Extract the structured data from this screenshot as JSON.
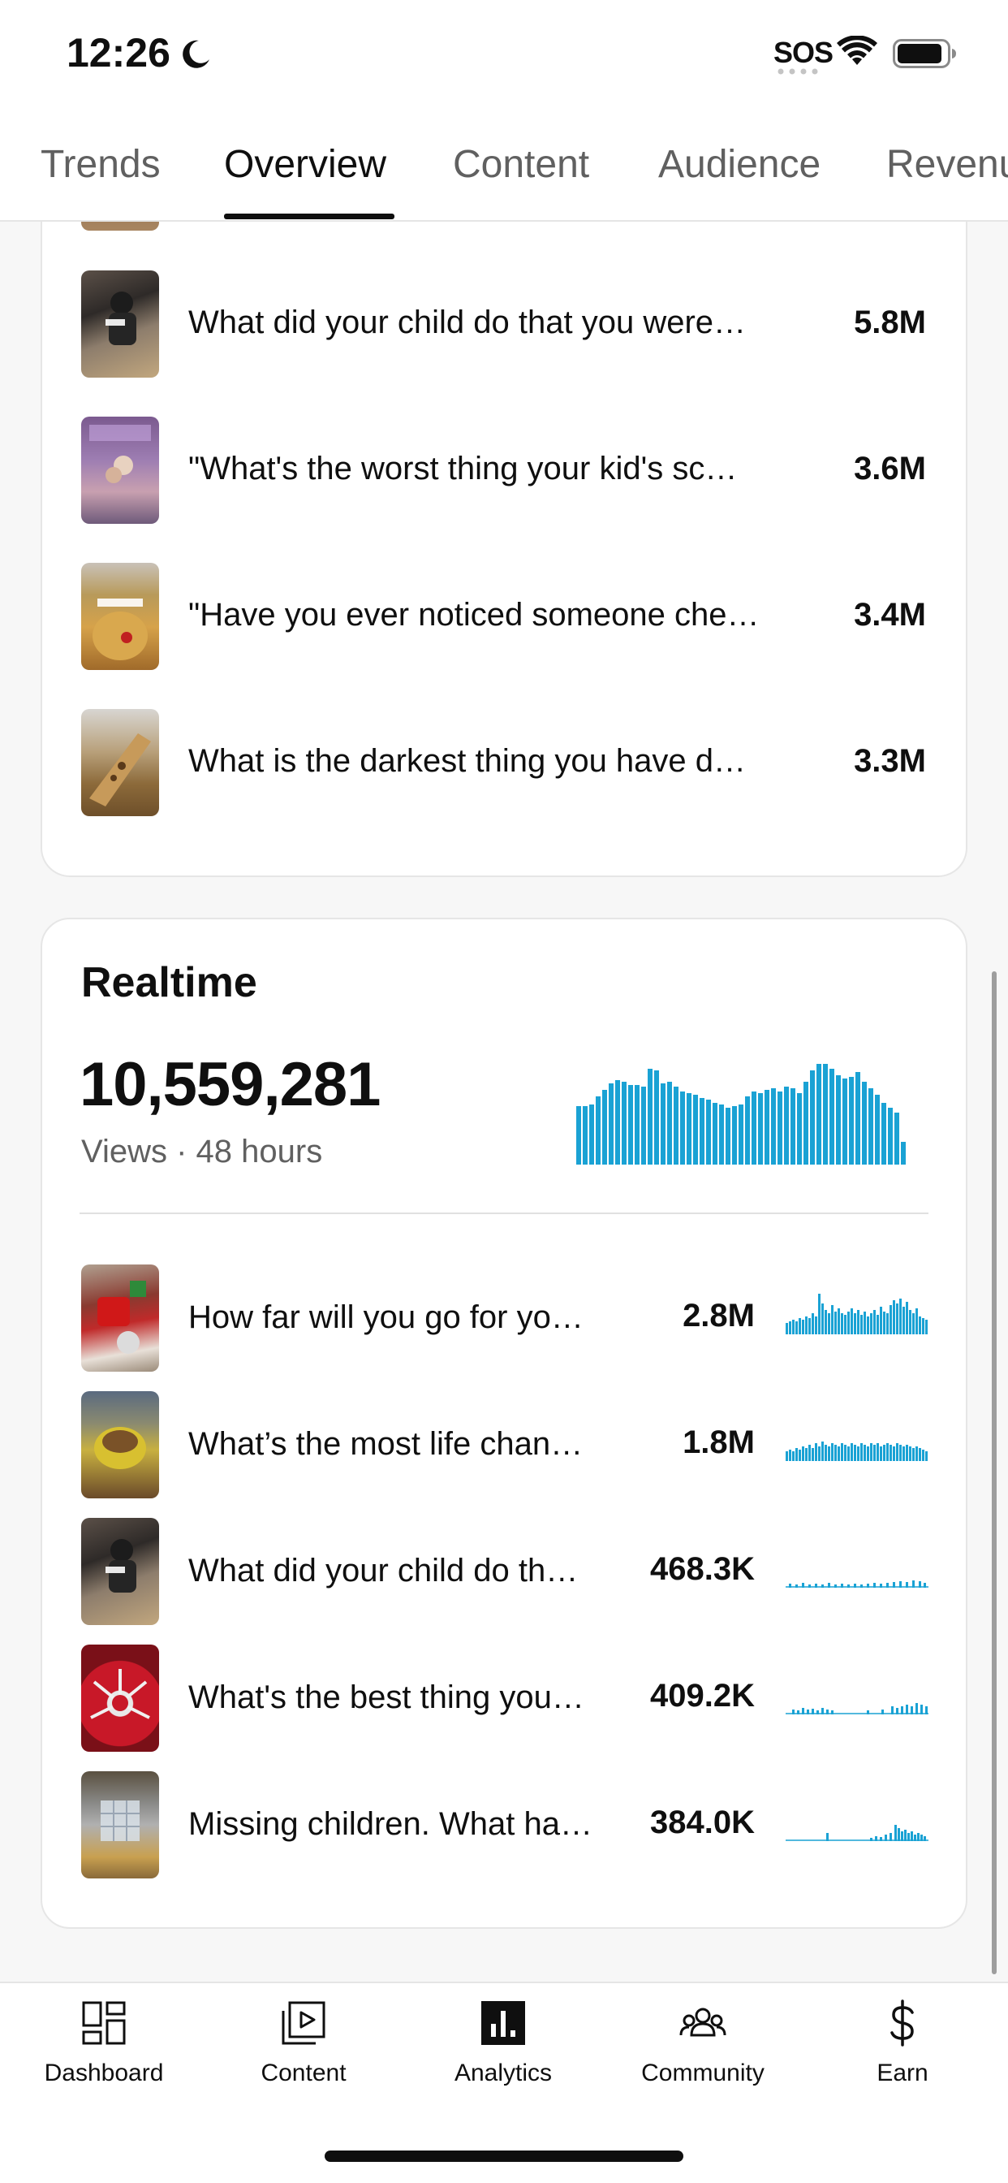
{
  "status_bar": {
    "time": "12:26",
    "sos": "SOS"
  },
  "tabs": [
    {
      "label": "Trends",
      "active": false
    },
    {
      "label": "Overview",
      "active": true
    },
    {
      "label": "Content",
      "active": false
    },
    {
      "label": "Audience",
      "active": false
    },
    {
      "label": "Revenue",
      "active": false
    }
  ],
  "top_content": {
    "items": [
      {
        "title": "What did your child do that you were…",
        "value": "5.8M"
      },
      {
        "title": "\"What's the worst thing your kid's sc…",
        "value": "3.6M"
      },
      {
        "title": "\"Have you ever noticed someone che…",
        "value": "3.4M"
      },
      {
        "title": "What is the darkest thing you have d…",
        "value": "3.3M"
      }
    ]
  },
  "realtime": {
    "heading": "Realtime",
    "total_views": "10,559,281",
    "subtitle": "Views · 48 hours",
    "accent_color": "#1aa2d4",
    "items": [
      {
        "title": "How far will you go for yo…",
        "value": "2.8M"
      },
      {
        "title": "What’s the most life chan…",
        "value": "1.8M"
      },
      {
        "title": "What did your child do th…",
        "value": "468.3K"
      },
      {
        "title": "What's the best thing you…",
        "value": "409.2K"
      },
      {
        "title": "Missing children. What ha…",
        "value": "384.0K"
      }
    ]
  },
  "bottom_nav": [
    {
      "label": "Dashboard",
      "icon": "dashboard-icon",
      "active": false
    },
    {
      "label": "Content",
      "icon": "content-icon",
      "active": false
    },
    {
      "label": "Analytics",
      "icon": "analytics-icon",
      "active": true
    },
    {
      "label": "Community",
      "icon": "community-icon",
      "active": false
    },
    {
      "label": "Earn",
      "icon": "dollar-icon",
      "active": false
    }
  ]
}
